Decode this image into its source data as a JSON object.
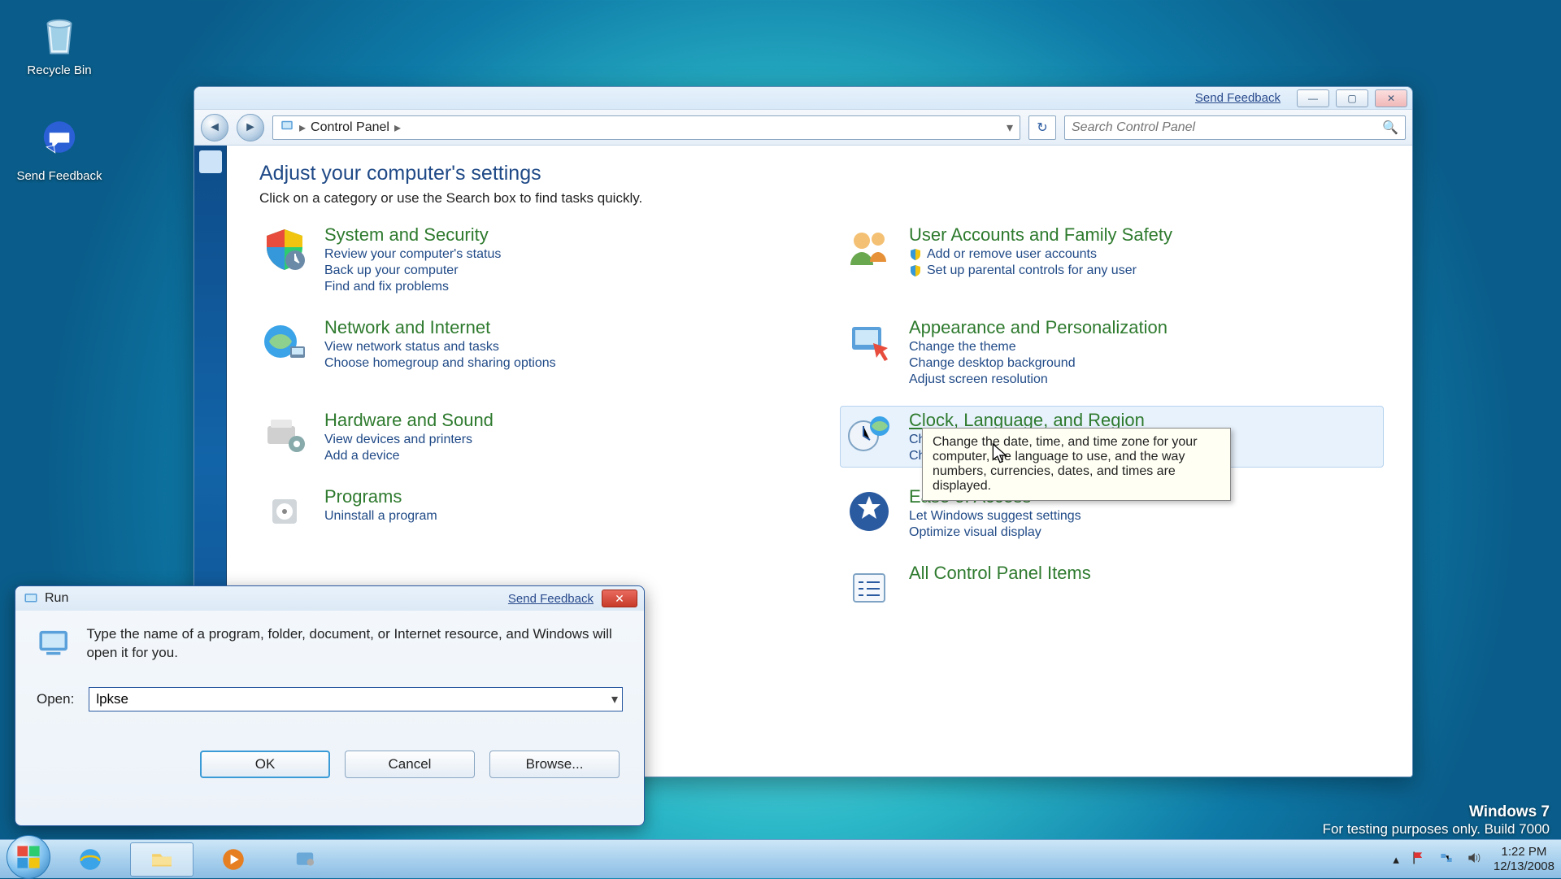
{
  "desktop": {
    "recycle_bin": "Recycle Bin",
    "send_feedback": "Send Feedback"
  },
  "cp": {
    "send_feedback": "Send Feedback",
    "breadcrumb_root": "Control Panel",
    "search_placeholder": "Search Control Panel",
    "heading": "Adjust your computer's settings",
    "subheading": "Click on a category or use the Search box to find tasks quickly.",
    "cats": [
      {
        "title": "System and Security",
        "links": [
          "Review your computer's status",
          "Back up your computer",
          "Find and fix problems"
        ]
      },
      {
        "title": "User Accounts and Family Safety",
        "links": [
          "Add or remove user accounts",
          "Set up parental controls for any user"
        ],
        "shield": true
      },
      {
        "title": "Network and Internet",
        "links": [
          "View network status and tasks",
          "Choose homegroup and sharing options"
        ]
      },
      {
        "title": "Appearance and Personalization",
        "links": [
          "Change the theme",
          "Change desktop background",
          "Adjust screen resolution"
        ]
      },
      {
        "title": "Hardware and Sound",
        "links": [
          "View devices and printers",
          "Add a device"
        ]
      },
      {
        "title": "Clock, Language, and Region",
        "links": [
          "Change keyboards or other input methods",
          "Change display language"
        ],
        "hover": true,
        "tooltip": "Change the date, time, and time zone for your computer, the language to use, and the way numbers, currencies, dates, and times are displayed."
      },
      {
        "title": "Programs",
        "links": [
          "Uninstall a program"
        ]
      },
      {
        "title": "Ease of Access",
        "links": [
          "Let Windows suggest settings",
          "Optimize visual display"
        ]
      },
      {
        "title": "All Control Panel Items",
        "links": []
      }
    ]
  },
  "run": {
    "title": "Run",
    "send_feedback": "Send Feedback",
    "description": "Type the name of a program, folder, document, or Internet resource, and Windows will open it for you.",
    "open_label": "Open:",
    "value": "lpkse",
    "ok": "OK",
    "cancel": "Cancel",
    "browse": "Browse..."
  },
  "watermark": {
    "line1": "Windows  7",
    "line2": "For testing purposes only. Build 7000"
  },
  "tray": {
    "time": "1:22 PM",
    "date": "12/13/2008"
  }
}
